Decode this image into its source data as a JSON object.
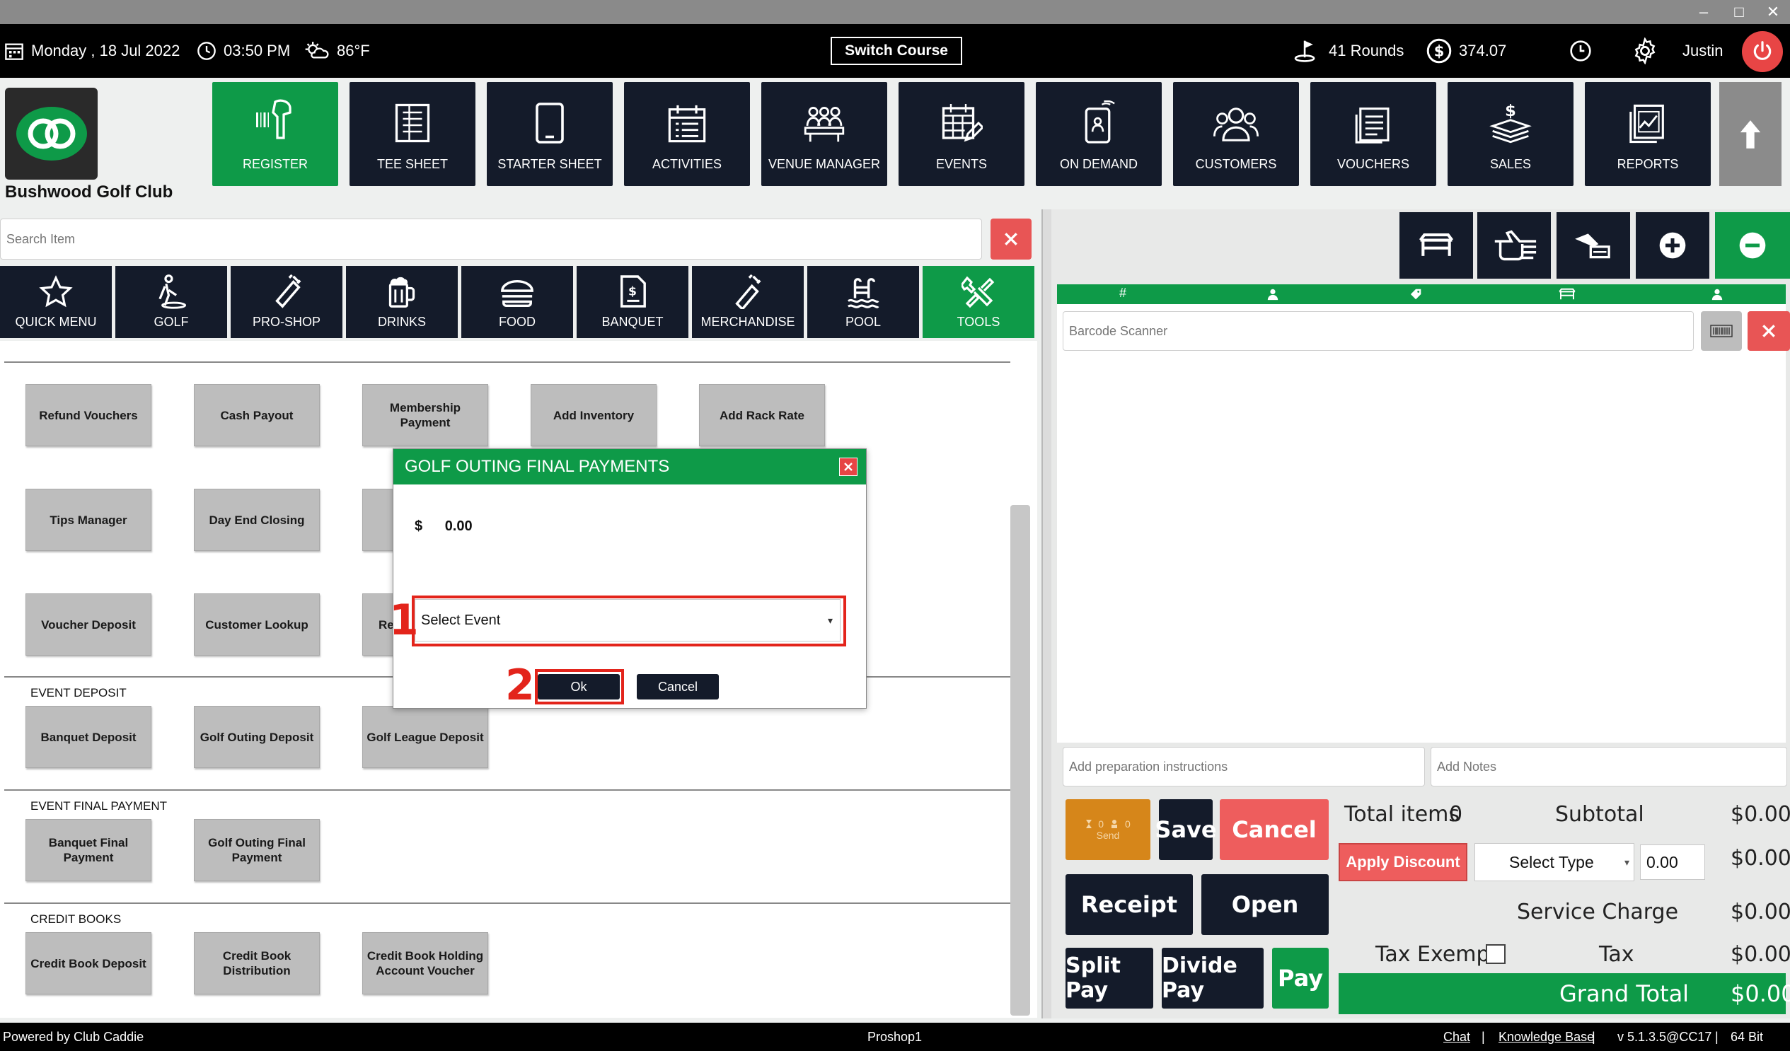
{
  "window": {
    "minimize": "–",
    "maximize": "□",
    "close": "✕"
  },
  "topbar": {
    "date": "Monday ,  18 Jul 2022",
    "time": "03:50 PM",
    "weather": "86°F",
    "switch_course": "Switch Course",
    "rounds": "41 Rounds",
    "balance": "374.07",
    "user": "Justin"
  },
  "club": {
    "name": "Bushwood Golf Club"
  },
  "nav": [
    {
      "label": "REGISTER",
      "icon": "scanner-icon"
    },
    {
      "label": "TEE SHEET",
      "icon": "tee-sheet-icon"
    },
    {
      "label": "STARTER SHEET",
      "icon": "tablet-icon"
    },
    {
      "label": "ACTIVITIES",
      "icon": "calendar-list-icon"
    },
    {
      "label": "VENUE MANAGER",
      "icon": "meeting-icon"
    },
    {
      "label": "EVENTS",
      "icon": "calendar-edit-icon"
    },
    {
      "label": "ON DEMAND",
      "icon": "phone-user-icon"
    },
    {
      "label": "CUSTOMERS",
      "icon": "users-icon"
    },
    {
      "label": "VOUCHERS",
      "icon": "voucher-icon"
    },
    {
      "label": "SALES",
      "icon": "cash-icon"
    },
    {
      "label": "REPORTS",
      "icon": "report-icon"
    }
  ],
  "search": {
    "placeholder": "Search Item"
  },
  "categories": [
    {
      "label": "QUICK MENU"
    },
    {
      "label": "GOLF"
    },
    {
      "label": "PRO-SHOP"
    },
    {
      "label": "DRINKS"
    },
    {
      "label": "FOOD"
    },
    {
      "label": "BANQUET"
    },
    {
      "label": "MERCHANDISE"
    },
    {
      "label": "POOL"
    },
    {
      "label": "TOOLS"
    }
  ],
  "tools": {
    "row1": [
      "Refund Vouchers",
      "Cash Payout",
      "Membership Payment",
      "Add Inventory",
      "Add Rack Rate"
    ],
    "row2": [
      "Tips Manager",
      "Day End Closing"
    ],
    "row3": [
      "Voucher Deposit",
      "Customer Lookup",
      "Re"
    ],
    "event_deposit_label": "EVENT DEPOSIT",
    "event_deposit": [
      "Banquet Deposit",
      "Golf Outing Deposit",
      "Golf League Deposit"
    ],
    "event_final_label": "EVENT FINAL PAYMENT",
    "event_final": [
      "Banquet Final Payment",
      "Golf Outing Final Payment"
    ],
    "credit_books_label": "CREDIT BOOKS",
    "credit_books": [
      "Credit Book Deposit",
      "Credit Book Distribution",
      "Credit Book Holding Account Voucher"
    ]
  },
  "cart": {
    "barcode_placeholder": "Barcode Scanner",
    "strip_headers": [
      "#",
      "person-icon",
      "tag-icon",
      "table-icon",
      "person-icon"
    ],
    "prep_placeholder": "Add preparation instructions",
    "notes_placeholder": "Add Notes",
    "send": {
      "label": "Send",
      "count1": "0",
      "count2": "0"
    },
    "save": "Save",
    "cancel": "Cancel",
    "receipt": "Receipt",
    "open": "Open",
    "split_pay": "Split Pay",
    "divide_pay": "Divide Pay",
    "pay": "Pay"
  },
  "totals": {
    "total_items_label": "Total items",
    "total_items": "0",
    "subtotal_label": "Subtotal",
    "subtotal": "$0.00",
    "apply_discount": "Apply Discount",
    "select_type": "Select Type",
    "discount_value": "0.00",
    "discount_amount": "$0.00",
    "service_charge_label": "Service Charge",
    "service_charge": "$0.00",
    "tax_exempt_label": "Tax Exempt",
    "tax_label": "Tax",
    "tax": "$0.00",
    "grand_total_label": "Grand Total",
    "grand_total": "$0.00"
  },
  "modal": {
    "title": "GOLF OUTING FINAL PAYMENTS",
    "currency": "$",
    "amount": "0.00",
    "select_event": "Select Event",
    "ok": "Ok",
    "cancel": "Cancel",
    "step1": "1",
    "step2": "2"
  },
  "footer": {
    "powered": "Powered by Club Caddie",
    "terminal": "Proshop1",
    "chat": "Chat",
    "sep1": "|",
    "kb": "Knowledge Base",
    "sep2": "|",
    "version": "v 5.1.3.5@CC17",
    "sep3": "|",
    "bits": "64 Bit"
  },
  "colors": {
    "green": "#0e9a48",
    "dark": "#141b2a",
    "red": "#ee5d5d",
    "orange": "#d6861a",
    "highlight": "#e3241b"
  }
}
